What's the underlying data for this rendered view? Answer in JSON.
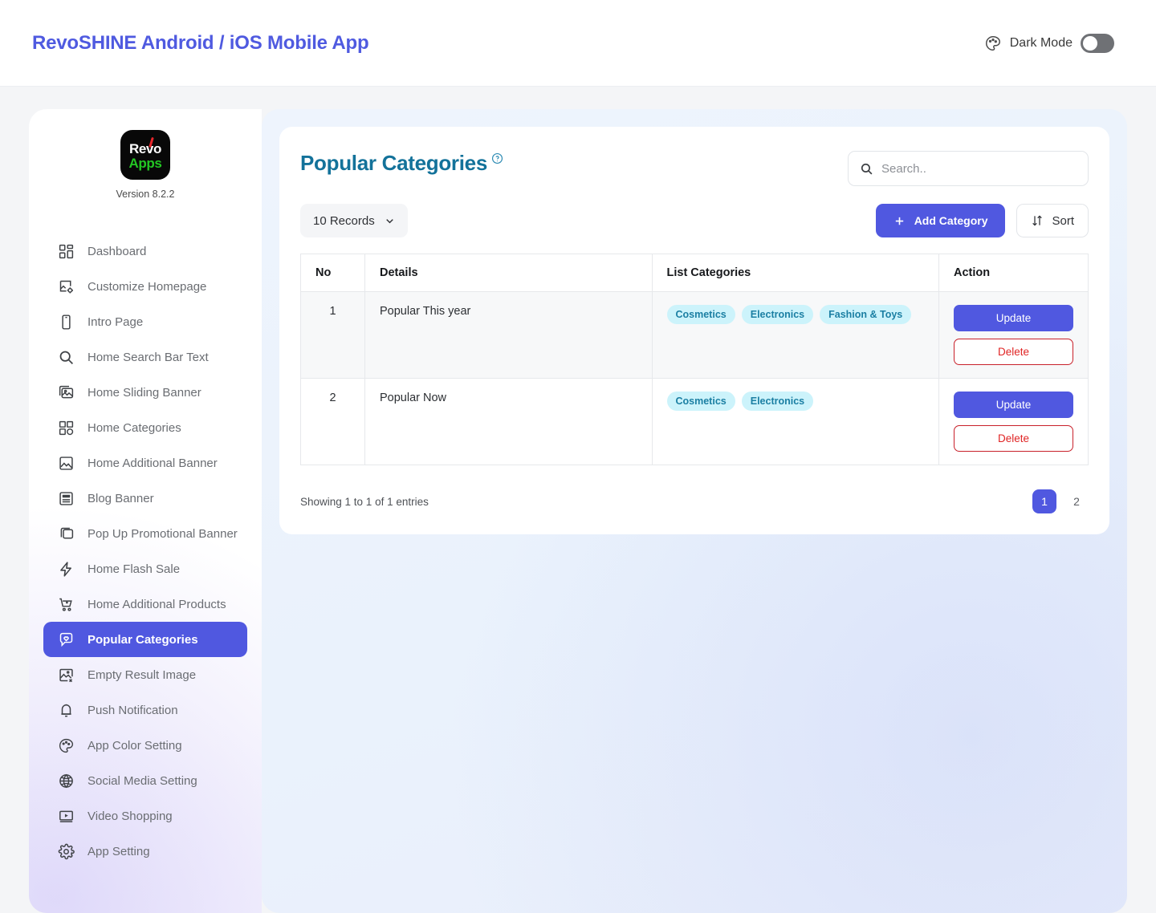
{
  "header": {
    "app_title": "RevoSHINE Android / iOS Mobile App",
    "dark_mode_label": "Dark Mode",
    "dark_mode_on": false,
    "palette_icon": "palette-icon",
    "brand_color": "#4f5ae0"
  },
  "sidebar": {
    "logo": {
      "top_text": "Revo",
      "bottom_text": "Apps"
    },
    "version": "Version 8.2.2",
    "items": [
      {
        "label": "Dashboard",
        "icon": "dashboard-grid-icon",
        "active": false
      },
      {
        "label": "Customize Homepage",
        "icon": "image-settings-icon",
        "active": false
      },
      {
        "label": "Intro Page",
        "icon": "mobile-phone-icon",
        "active": false
      },
      {
        "label": "Home Search Bar Text",
        "icon": "search-icon",
        "active": false
      },
      {
        "label": "Home Sliding Banner",
        "icon": "images-stack-icon",
        "active": false
      },
      {
        "label": "Home Categories",
        "icon": "grid-dot-icon",
        "active": false
      },
      {
        "label": "Home Additional Banner",
        "icon": "picture-icon",
        "active": false
      },
      {
        "label": "Blog Banner",
        "icon": "article-icon",
        "active": false
      },
      {
        "label": "Pop Up Promotional Banner",
        "icon": "windows-icon",
        "active": false
      },
      {
        "label": "Home Flash Sale",
        "icon": "lightning-bolt-icon",
        "active": false
      },
      {
        "label": "Home Additional Products",
        "icon": "cart-plus-icon",
        "active": false
      },
      {
        "label": "Popular Categories",
        "icon": "heart-bubble-icon",
        "active": true
      },
      {
        "label": "Empty Result Image",
        "icon": "image-x-icon",
        "active": false
      },
      {
        "label": "Push Notification",
        "icon": "bell-icon",
        "active": false
      },
      {
        "label": "App Color Setting",
        "icon": "palette-icon",
        "active": false
      },
      {
        "label": "Social Media Setting",
        "icon": "globe-icon",
        "active": false
      },
      {
        "label": "Video Shopping",
        "icon": "video-play-icon",
        "active": false
      },
      {
        "label": "App Setting",
        "icon": "gear-icon",
        "active": false
      }
    ]
  },
  "main": {
    "page_title": "Popular Categories",
    "help_icon": "question-circle-icon",
    "search": {
      "value": "",
      "placeholder": "Search.."
    },
    "records_select": {
      "value": "10 Records"
    },
    "add_button": "Add Category",
    "sort_button": "Sort",
    "table": {
      "columns": [
        "No",
        "Details",
        "List Categories",
        "Action"
      ],
      "rows": [
        {
          "no": "1",
          "details": "Popular This year",
          "categories": [
            "Cosmetics",
            "Electronics",
            "Fashion & Toys"
          ],
          "update_label": "Update",
          "delete_label": "Delete"
        },
        {
          "no": "2",
          "details": "Popular Now",
          "categories": [
            "Cosmetics",
            "Electronics"
          ],
          "update_label": "Update",
          "delete_label": "Delete"
        }
      ]
    },
    "showing_text": "Showing 1 to 1 of 1 entries",
    "pagination": {
      "pages": [
        "1",
        "2"
      ],
      "active": "1"
    }
  }
}
